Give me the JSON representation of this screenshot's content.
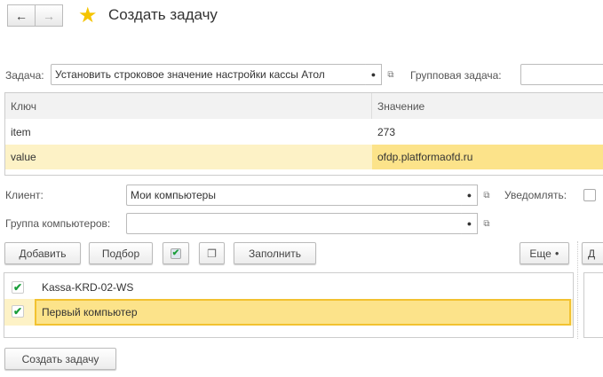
{
  "header": {
    "title": "Создать задачу",
    "back": "←",
    "forward": "→"
  },
  "task": {
    "label": "Задача:",
    "value": "Установить строковое значение настройки кассы Атол",
    "group_label": "Групповая задача:",
    "group_value": ""
  },
  "params_table": {
    "columns": [
      "Ключ",
      "Значение"
    ],
    "rows": [
      {
        "key": "item",
        "value": "273"
      },
      {
        "key": "value",
        "value": "ofdp.platformaofd.ru"
      }
    ]
  },
  "client": {
    "label": "Клиент:",
    "value": "Мои компьютеры",
    "notify_label": "Уведомлять:"
  },
  "group": {
    "label": "Группа компьютеров:",
    "value": ""
  },
  "toolbar": {
    "add": "Добавить",
    "pick": "Подбор",
    "fill": "Заполнить",
    "more": "Еще",
    "right": "Д"
  },
  "computers": [
    {
      "name": "Kassa-KRD-02-WS",
      "checked": true
    },
    {
      "name": "Первый компьютер",
      "checked": true
    }
  ],
  "create_button": "Создать задачу",
  "colors": {
    "selected_row": "#fdf2c6",
    "selected_cell": "#fce38a",
    "accent_star": "#f5c400"
  }
}
